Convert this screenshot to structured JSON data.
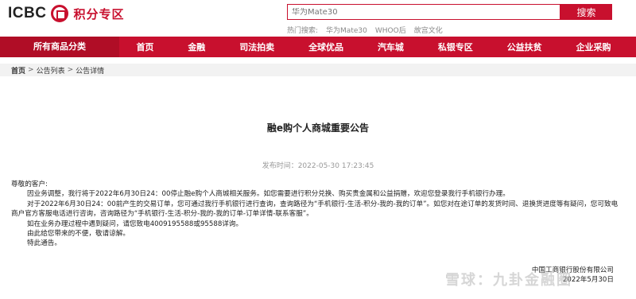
{
  "header": {
    "logo_text": "ICBC",
    "logo_title": "积分专区",
    "search_placeholder": "华为Mate30",
    "search_button": "搜索",
    "hot_label": "热门搜索:",
    "hot_items": [
      "华为Mate30",
      "WHOO后",
      "故宫文化"
    ]
  },
  "nav": {
    "all_label": "所有商品分类",
    "items": [
      "首页",
      "金融",
      "司法拍卖",
      "全球优品",
      "汽车城",
      "私银专区",
      "公益扶贫",
      "企业采购"
    ]
  },
  "breadcrumb": {
    "home": "首页",
    "sep": ">",
    "list": "公告列表",
    "detail": "公告详情"
  },
  "article": {
    "title": "融e购个人商城重要公告",
    "pubtime": "发布时间：2022-05-30 17:23:45",
    "greeting": "尊敬的客户:",
    "para1": "因业务调整，我行将于2022年6月30日24：00停止融e购个人商城相关服务。如您需要进行积分兑换、购买贵金属和公益捐赠，欢迎您登录我行手机银行办理。",
    "para2": "对于2022年6月30日24：00前产生的交易订单，您可通过我行手机银行进行查询，查询路径为“手机银行-生活-积分-我的-我的订单”。如您对在途订单的发货时间、退换货进度等有疑问，您可致电商户官方客服电话进行咨询，咨询路径为“手机银行-生活-积分-我的-我的订单-订单详情-联系客服”。",
    "para3": "如在业务办理过程中遇到疑问，请您致电4009195588或95588详询。",
    "para4": "由此给您带来的不便，敬请谅解。",
    "para5": "特此通告。",
    "sign_org": "中国工商银行股份有限公司",
    "sign_date": "2022年5月30日"
  },
  "watermark": "雪球：九卦金融圈",
  "colors": {
    "brand": "#c8102e"
  }
}
